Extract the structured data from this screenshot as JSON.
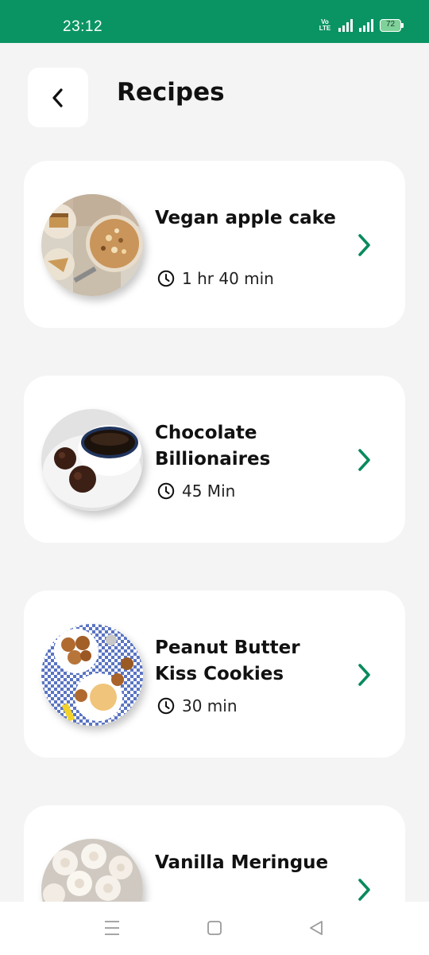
{
  "status_bar": {
    "time": "23:12",
    "network_top": "Vo",
    "network_bottom": "LTE",
    "battery": "72"
  },
  "header": {
    "title": "Recipes",
    "back_icon": "chevron-left-icon"
  },
  "recipes": [
    {
      "name": "Vegan apple cake",
      "time": "1 hr 40 min"
    },
    {
      "name": "Chocolate Billionaires",
      "time": "45 Min"
    },
    {
      "name": "Peanut Butter Kiss Cookies",
      "time": "30 min"
    },
    {
      "name": "Vanilla Meringue",
      "time": ""
    }
  ],
  "nav_bar": {
    "buttons": [
      "menu-icon",
      "home-square-icon",
      "back-triangle-icon"
    ]
  },
  "colors": {
    "accent": "#0a9463",
    "background": "#f4f4f4",
    "card": "#ffffff",
    "text": "#111111"
  }
}
